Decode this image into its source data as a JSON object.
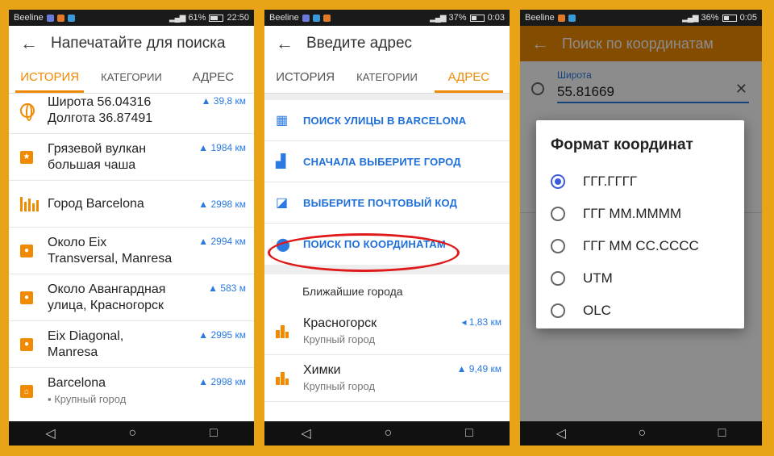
{
  "status1": {
    "carrier": "Beeline",
    "battery": "61%",
    "time": "22:50"
  },
  "status2": {
    "carrier": "Beeline",
    "battery": "37%",
    "time": "0:03"
  },
  "status3": {
    "carrier": "Beeline",
    "battery": "36%",
    "time": "0:05"
  },
  "screen1": {
    "title": "Напечатайте для поиска",
    "tabs": [
      "ИСТОРИЯ",
      "КАТЕГОРИИ",
      "АДРЕС"
    ],
    "items": [
      {
        "line1": "Широта 56.04316",
        "line2": "Долгота 36.87491",
        "dist": "39,8 км"
      },
      {
        "line1": "Грязевой вулкан",
        "line2": "большая чаша",
        "dist": "1984 км"
      },
      {
        "line1": "Город Barcelona",
        "line2": "",
        "dist": "2998 км"
      },
      {
        "line1": "Около Eix",
        "line2": "Transversal, Manresa",
        "dist": "2994 км"
      },
      {
        "line1": "Около Авангардная",
        "line2": "улица, Красногорск",
        "dist": "583 м"
      },
      {
        "line1": "Eix Diagonal,",
        "line2": "Manresa",
        "dist": "2995 км"
      },
      {
        "line1": "Barcelona",
        "line2": "Крупный город",
        "dist": "2998 км"
      }
    ]
  },
  "screen2": {
    "title": "Введите адрес",
    "tabs": [
      "ИСТОРИЯ",
      "КАТЕГОРИИ",
      "АДРЕС"
    ],
    "actions": [
      "ПОИСК УЛИЦЫ В BARCELONA",
      "СНАЧАЛА ВЫБЕРИТЕ ГОРОД",
      "ВЫБЕРИТЕ ПОЧТОВЫЙ КОД",
      "ПОИСК ПО КООРДИНАТАМ"
    ],
    "nearby_title": "Ближайшие города",
    "cities": [
      {
        "name": "Красногорск",
        "type": "Крупный город",
        "dist": "1,83 км"
      },
      {
        "name": "Химки",
        "type": "Крупный город",
        "dist": "9,49 км"
      }
    ]
  },
  "screen3": {
    "title": "Поиск по координатам",
    "field_label": "Широта",
    "field_value": "55.81669",
    "dialog_title": "Формат координат",
    "options": [
      "ГГГ.ГГГГ",
      "ГГГ ММ.ММММ",
      "ГГГ ММ СС.СССС",
      "UTM",
      "OLC"
    ],
    "selected_option": "ГГГ.ГГГГ"
  },
  "colors": {
    "accent": "#f08a00",
    "link": "#1e6fd9",
    "highlight_ring": "#e01a1a",
    "frame": "#e8a317"
  }
}
